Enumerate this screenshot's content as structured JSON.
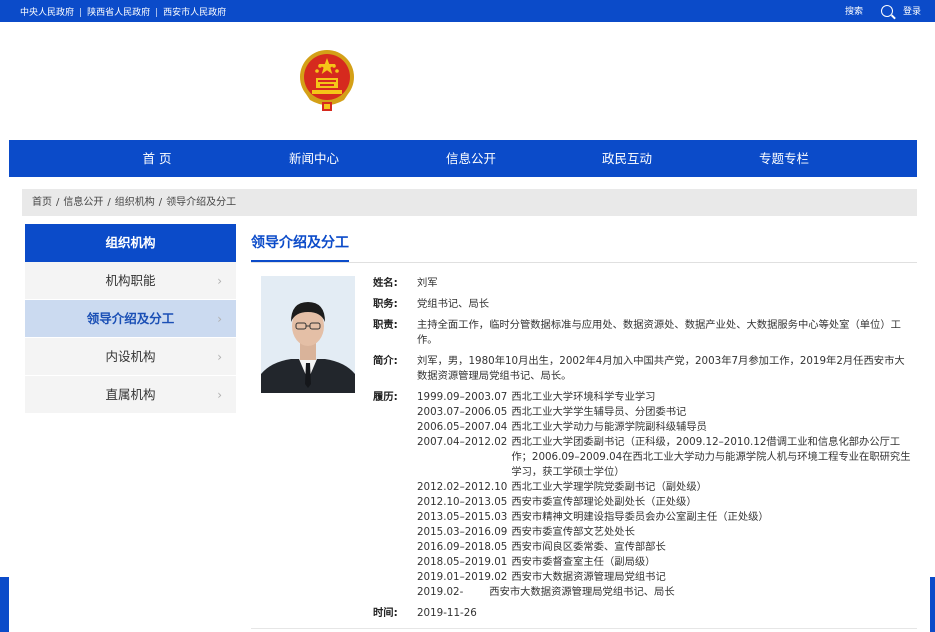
{
  "topbar": {
    "link_central": "中央人民政府",
    "link_shaanxi": "陕西省人民政府",
    "link_xian": "西安市人民政府",
    "sep": "|",
    "search_label": "搜索",
    "login_label": "登录"
  },
  "nav": {
    "items": [
      "首 页",
      "新闻中心",
      "信息公开",
      "政民互动",
      "专题专栏"
    ]
  },
  "breadcrumb": [
    "首页",
    "信息公开",
    "组织机构",
    "领导介绍及分工"
  ],
  "crumb_sep": "/",
  "sidebar": {
    "title": "组织机构",
    "items": [
      {
        "label": "机构职能",
        "active": false
      },
      {
        "label": "领导介绍及分工",
        "active": true
      },
      {
        "label": "内设机构",
        "active": false
      },
      {
        "label": "直属机构",
        "active": false
      }
    ]
  },
  "content": {
    "title": "领导介绍及分工",
    "name_label": "姓名:",
    "name": "刘军",
    "position_label": "职务:",
    "position": "党组书记、局长",
    "duty_label": "职责:",
    "duty": "主持全面工作，临时分管数据标准与应用处、数据资源处、数据产业处、大数据服务中心等处室（单位）工作。",
    "bio_label": "简介:",
    "bio": "刘军，男，1980年10月出生，2002年4月加入中国共产党，2003年7月参加工作，2019年2月任西安市大数据资源管理局党组书记、局长。",
    "resume_label": "履历:",
    "resume": [
      {
        "period": "1999.09–2003.07",
        "text": "西北工业大学环境科学专业学习"
      },
      {
        "period": "2003.07–2006.05",
        "text": "西北工业大学学生辅导员、分团委书记"
      },
      {
        "period": "2006.05–2007.04",
        "text": "西北工业大学动力与能源学院副科级辅导员"
      },
      {
        "period": "2007.04–2012.02",
        "text": "西北工业大学团委副书记（正科级，2009.12–2010.12借调工业和信息化部办公厅工作；2006.09–2009.04在西北工业大学动力与能源学院人机与环境工程专业在职研究生学习，获工学硕士学位）"
      },
      {
        "period": "2012.02–2012.10",
        "text": "西北工业大学理学院党委副书记（副处级）"
      },
      {
        "period": "2012.10–2013.05",
        "text": "西安市委宣传部理论处副处长（正处级）"
      },
      {
        "period": "2013.05–2015.03",
        "text": "西安市精神文明建设指导委员会办公室副主任（正处级）"
      },
      {
        "period": "2015.03–2016.09",
        "text": "西安市委宣传部文艺处处长"
      },
      {
        "period": "2016.09–2018.05",
        "text": "西安市阎良区委常委、宣传部部长"
      },
      {
        "period": "2018.05–2019.01",
        "text": "西安市委督查室主任（副局级）"
      },
      {
        "period": "2019.01–2019.02",
        "text": "西安市大数据资源管理局党组书记"
      },
      {
        "period": "2019.02-",
        "text": "西安市大数据资源管理局党组书记、局长"
      }
    ],
    "time_label": "时间:",
    "time": "2019-11-26"
  },
  "colors": {
    "brand_blue": "#0b4bc9",
    "sidebar_active_bg": "#cbdaf0"
  }
}
